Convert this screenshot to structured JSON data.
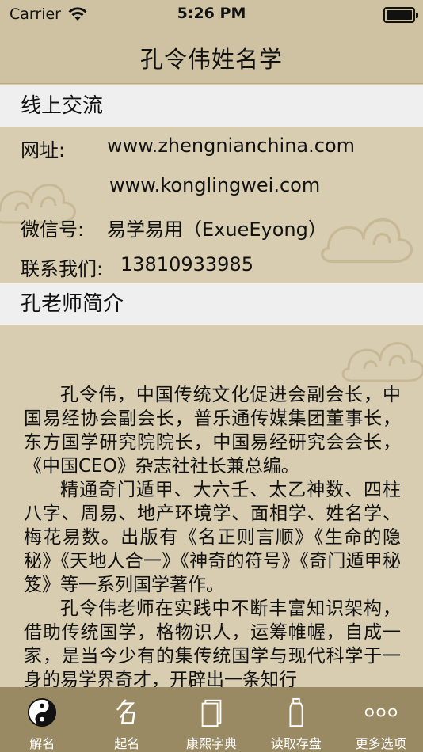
{
  "status": {
    "carrier": "Carrier",
    "time": "5:26 PM"
  },
  "nav": {
    "title": "孔令伟姓名学"
  },
  "contact": {
    "heading": "线上交流",
    "website_label": "网址:",
    "website_1": "www.zhengnianchina.com",
    "website_2": "www.konglingwei.com",
    "wechat_label": "微信号:",
    "wechat_value": "易学易用（ExueEyong）",
    "phone_label": "联系我们:",
    "phone_value": "13810933985"
  },
  "bio": {
    "heading": "孔老师简介",
    "paragraphs": [
      "孔令伟，中国传统文化促进会副会长，中国易经协会副会长，普乐通传媒集团董事长，东方国学研究院院长，中国易经研究会会长，《中国CEO》杂志社社长兼总编。",
      "精通奇门遁甲、大六壬、太乙神数、四柱八字、周易、地产环境学、面相学、姓名学、梅花易数。出版有《名正则言顺》《生命的隐秘》《天地人合一》《神奇的符号》《奇门遁甲秘笈》等一系列国学著作。",
      "孔令伟老师在实践中不断丰富知识架构，借助传统国学，格物识人，运筹帷幄，自成一家，是当今少有的集传统国学与现代科学于一身的易学界奇才，开辟出一条知行"
    ]
  },
  "tabs": [
    {
      "label": "解名",
      "icon": "yin-yang-icon"
    },
    {
      "label": "起名",
      "icon": "name-calligraphy-icon"
    },
    {
      "label": "康熙字典",
      "icon": "book-icon"
    },
    {
      "label": "读取存盘",
      "icon": "bottle-icon"
    },
    {
      "label": "更多选项",
      "icon": "more-dots-icon"
    }
  ]
}
